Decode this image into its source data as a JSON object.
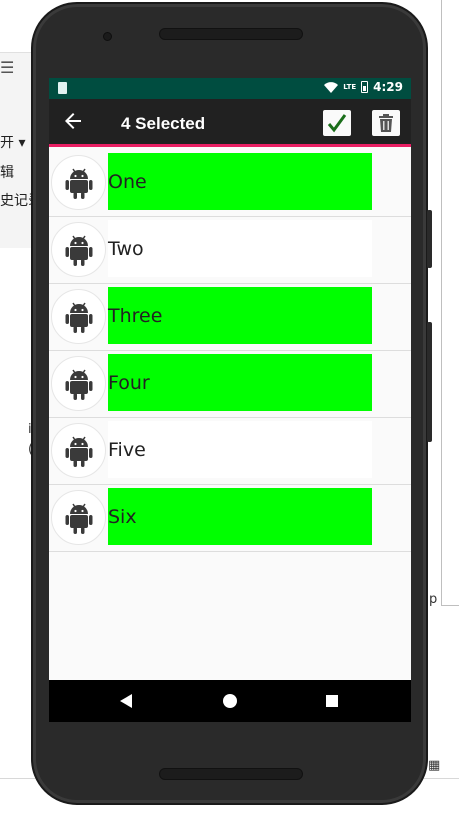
{
  "background": {
    "left_texts": [
      "开 ▾",
      "辑",
      "史记录"
    ],
    "stray_chars": [
      "i",
      "(",
      "p"
    ]
  },
  "status_bar": {
    "time": "4:29",
    "network": "LTE",
    "color": "#004d40"
  },
  "toolbar": {
    "back_icon": "arrow-left-icon",
    "title": "4 Selected",
    "confirm_icon": "checkmark-icon",
    "delete_icon": "trash-icon",
    "accent": "#e91e63"
  },
  "list": {
    "selected_color": "#00ff00",
    "items": [
      {
        "label": "One",
        "selected": true,
        "icon": "android-icon"
      },
      {
        "label": "Two",
        "selected": false,
        "icon": "android-icon"
      },
      {
        "label": "Three",
        "selected": true,
        "icon": "android-icon"
      },
      {
        "label": "Four",
        "selected": true,
        "icon": "android-icon"
      },
      {
        "label": "Five",
        "selected": false,
        "icon": "android-icon"
      },
      {
        "label": "Six",
        "selected": true,
        "icon": "android-icon"
      }
    ]
  },
  "nav_bar": {
    "back": "nav-back-icon",
    "home": "nav-home-icon",
    "recents": "nav-recents-icon"
  }
}
